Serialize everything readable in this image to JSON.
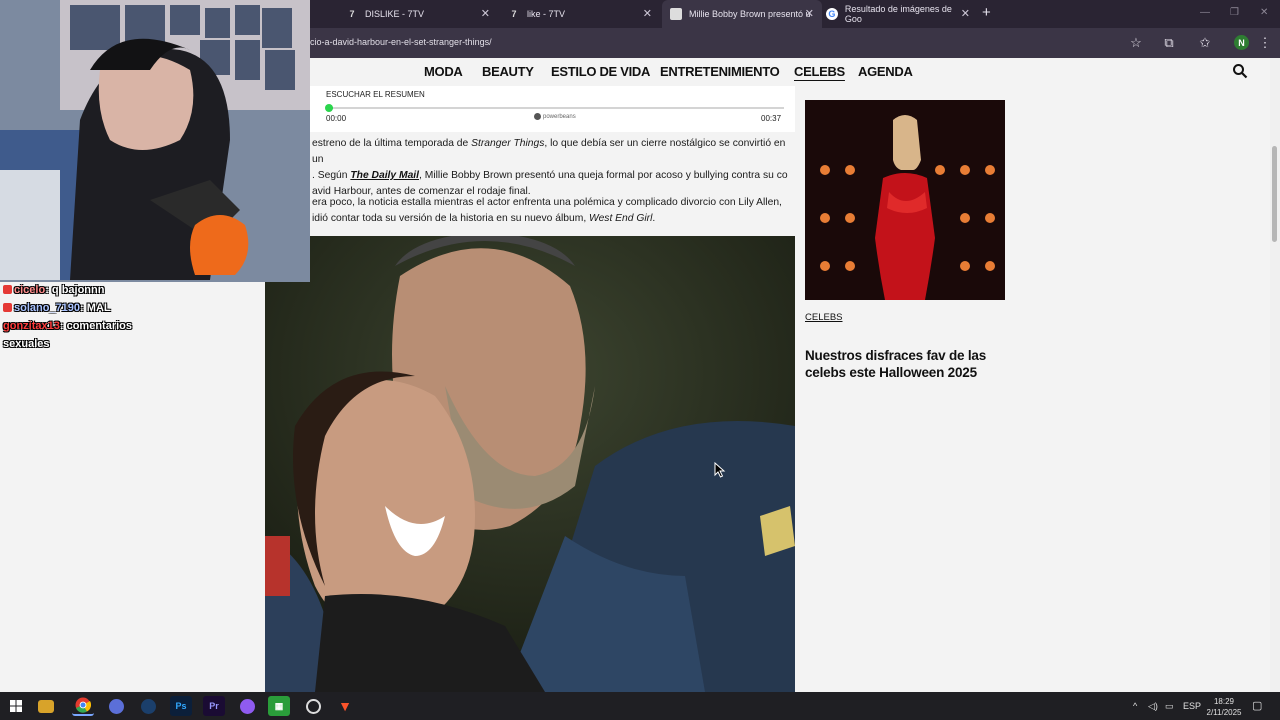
{
  "browser": {
    "tabs": [
      {
        "label": "DISLIKE - 7TV",
        "icon": "7tv-icon"
      },
      {
        "label": "like - 7TV",
        "icon": "7tv-icon"
      },
      {
        "label": "Millie Bobby Brown presentó u",
        "icon": "site-icon",
        "active": true
      },
      {
        "label": "Resultado de imágenes de Goo",
        "icon": "google-icon"
      }
    ],
    "url": "cio-a-david-harbour-en-el-set-stranger-things/",
    "profile_initial": "N"
  },
  "site": {
    "nav": [
      "MODA",
      "BEAUTY",
      "ESTILO DE VIDA",
      "ENTRETENIMIENTO",
      "CELEBS",
      "AGENDA"
    ],
    "active_nav": "CELEBS",
    "player": {
      "title": "ESCUCHAR EL RESUMEN",
      "time_start": "00:00",
      "time_end": "00:37",
      "progress_pct": 1,
      "powered_by": "powerbeans"
    },
    "article": {
      "p1_a": "estreno de la última temporada de ",
      "p1_b": "Stranger Things",
      "p1_c": ", lo que debía ser un cierre nostálgico se convirtió en un",
      "p1_d": ". Según ",
      "p1_link": "The Daily Mail",
      "p1_e": ", Millie Bobby Brown presentó una queja formal por acoso y bullying contra su co",
      "p1_f": "avid Harbour, antes de comenzar el rodaje final.",
      "p2_a": "era poco, la noticia estalla mientras el actor enfrenta una polémica y complicado divorcio con Lily Allen,",
      "p2_b": "idió contar toda su versión de la historia en su nuevo álbum, ",
      "p2_c": "West End Girl",
      "p2_d": "."
    },
    "sidebar": {
      "tag": "CELEBS",
      "title": "Nuestros disfraces fav de las celebs este Halloween 2025"
    }
  },
  "chat": [
    {
      "user": "cicelo",
      "message": "q bajonnn",
      "badge_color": "#e53935"
    },
    {
      "user": "solano_7190",
      "message": "MAL",
      "badge_color": "#e53935"
    },
    {
      "user": "gonzitax13",
      "message": "comentarios",
      "badge_color": null
    },
    {
      "user": "",
      "message": "sexuales",
      "badge_color": null
    }
  ],
  "taskbar": {
    "language": "ESP",
    "time": "18:29",
    "date": "2/11/2025"
  }
}
